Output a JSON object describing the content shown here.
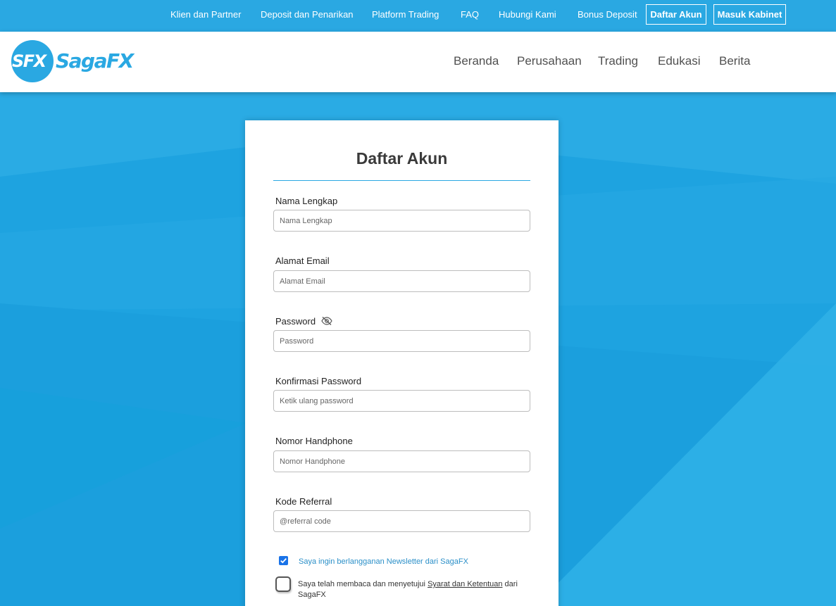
{
  "topbar": {
    "links": [
      "Klien dan Partner",
      "Deposit dan Penarikan",
      "Platform Trading",
      "FAQ",
      "Hubungi Kami",
      "Bonus Deposit"
    ],
    "register_button": "Daftar Akun",
    "login_button": "Masuk Kabinet"
  },
  "header": {
    "logo_mark": "SFX",
    "logo_name": "SagaFX",
    "nav": [
      "Beranda",
      "Perusahaan",
      "Trading",
      "Edukasi",
      "Berita"
    ]
  },
  "form": {
    "title": "Daftar Akun",
    "fields": [
      {
        "label": "Nama Lengkap",
        "placeholder": "Nama Lengkap",
        "value": ""
      },
      {
        "label": "Alamat Email",
        "placeholder": "Alamat Email",
        "value": ""
      },
      {
        "label": "Password",
        "placeholder": "Password",
        "value": ""
      },
      {
        "label": "Konfirmasi Password",
        "placeholder": "Ketik ulang password",
        "value": ""
      },
      {
        "label": "Nomor Handphone",
        "placeholder": "Nomor Handphone",
        "value": ""
      },
      {
        "label": "Kode Referral",
        "placeholder": "@referral code",
        "value": ""
      }
    ],
    "newsletter": {
      "label": "Saya ingin berlangganan Newsletter dari SagaFX",
      "checked": true
    },
    "terms": {
      "prefix": "Saya telah membaca dan menyetujui ",
      "link": "Syarat dan Ketentuan",
      "suffix": " dari SagaFX",
      "checked": false
    }
  },
  "colors": {
    "brand_blue": "#2aa8e2",
    "background_blue": "#1ea3e0",
    "checkbox_blue": "#1a73e8"
  },
  "icons": {
    "password_toggle": "eye-slash-icon",
    "newsletter_check": "checkmark-icon"
  }
}
